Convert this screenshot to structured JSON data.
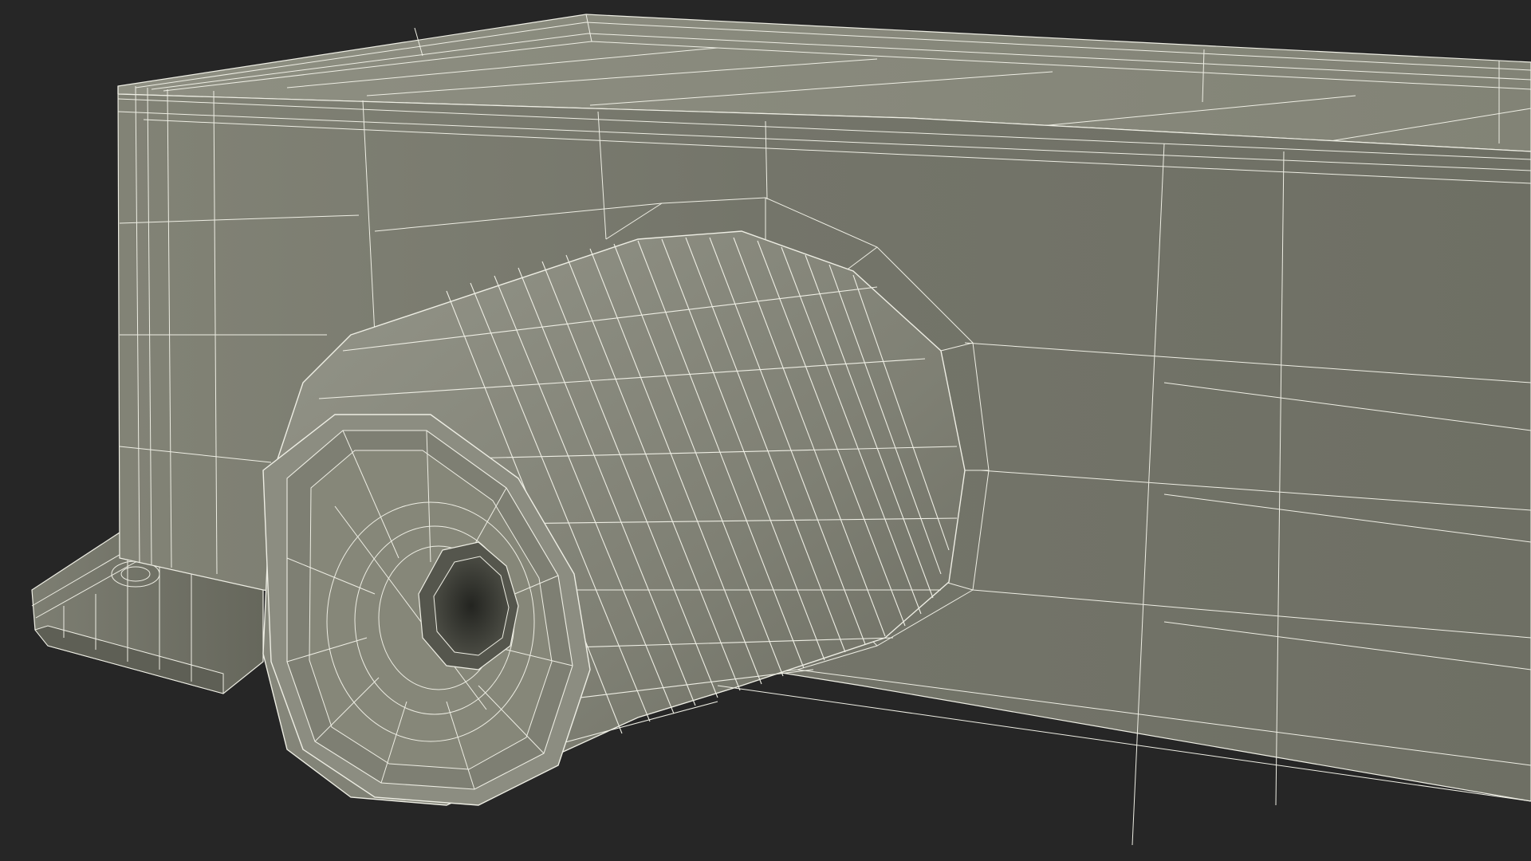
{
  "scene": {
    "subject": "wireframe-render",
    "colors": {
      "background": "#262626",
      "surface_light": "#8a8b7e",
      "surface_mid": "#7a7b6f",
      "surface_dark": "#616257",
      "wire": "#eeeee4",
      "hole": "#2a2b26"
    }
  }
}
